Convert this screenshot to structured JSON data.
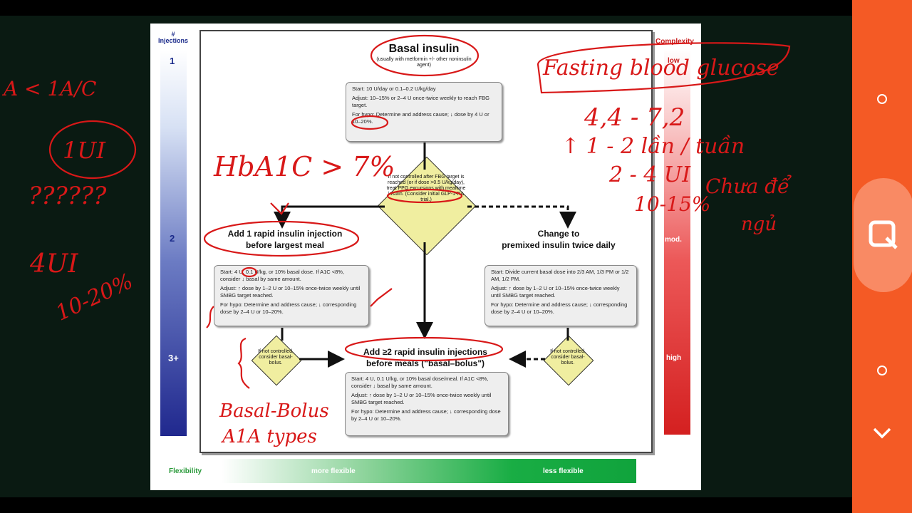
{
  "slide": {
    "left_label_line1": "#",
    "left_label_line2": "Injections",
    "left_ticks": [
      "1",
      "2",
      "3+"
    ],
    "complexity_label": "Complexity",
    "complexity_ticks": [
      "low",
      "mod.",
      "high"
    ],
    "flexibility_label": "Flexibility",
    "more_flexible": "more flexible",
    "less_flexible": "less flexible",
    "basal": {
      "title": "Basal insulin",
      "subtitle": "(usually with metformin +/- other noninsulin agent)",
      "start": "Start: 10 U/day or 0.1–0.2 U/kg/day",
      "adjust": "Adjust: 10–15% or 2–4 U once-twice weekly to reach FBG target.",
      "hypo": "For hypo: Determine and address cause; ↓ dose by 4 U or 10–20%."
    },
    "center_diamond": "If not controlled after FBG target is reached (or if dose >0.5 U/kg/day), treat PPG excursions with mealtime insulin. (Consider initial GLP-1-RA trial.)",
    "rapid1": {
      "title_line1": "Add 1 rapid insulin injection",
      "title_line2": "before largest meal",
      "start": "Start: 4 U, 0.1 U/kg, or 10% basal dose. If A1C <8%, consider ↓ basal by same amount.",
      "adjust": "Adjust: ↑ dose by 1–2 U or 10–15% once-twice weekly until SMBG target reached.",
      "hypo": "For hypo: Determine and address cause; ↓ corresponding dose by 2–4 U or 10–20%."
    },
    "premixed": {
      "title_line1": "Change to",
      "title_line2": "premixed insulin twice daily",
      "start": "Start: Divide current basal dose into 2/3 AM, 1/3 PM or 1/2 AM, 1/2 PM.",
      "adjust": "Adjust: ↑ dose by 1–2 U or 10–15% once-twice weekly until SMBG target reached.",
      "hypo": "For hypo: Determine and address cause; ↓ corresponding dose by 2–4 U or 10–20%."
    },
    "left_diamond": "If not controlled, consider basal-bolus.",
    "right_diamond": "If not controlled, consider basal-bolus.",
    "rapid2": {
      "title_line1": "Add ≥2 rapid insulin injections",
      "title_line2": "before meals (\"basal–bolus\")",
      "start": "Start: 4 U, 0.1 U/kg, or 10% basal dose/meal. If A1C <8%, consider ↓ basal by same amount.",
      "adjust": "Adjust: ↑ dose by 1–2 U or 10–15% once-twice weekly until SMBG target reached.",
      "hypo": "For hypo: Determine and address cause; ↓ corresponding dose by 2–4 U or 10–20%."
    }
  },
  "handwriting": {
    "top_left": "A < 1A/C",
    "circled": "1UI",
    "question": "??????",
    "fourui": "4UI",
    "range_left": "10-20%",
    "hba1c": "HbA1C > 7%",
    "fasting": "Fasting blood glucose",
    "fasting_range": "4,4 - 7,2",
    "per_week": "↑ 1 - 2 lần / tuần",
    "two_four": "2 - 4 UI",
    "ten_fifteen": "10-15%",
    "chua_de": "Chưa để",
    "ngu": "ngủ",
    "basal_bolus": "Basal-Bolus",
    "types": "A1A types"
  },
  "sidebar": {
    "buttons": [
      "circle",
      "zoom",
      "circle",
      "chevron-down"
    ]
  }
}
